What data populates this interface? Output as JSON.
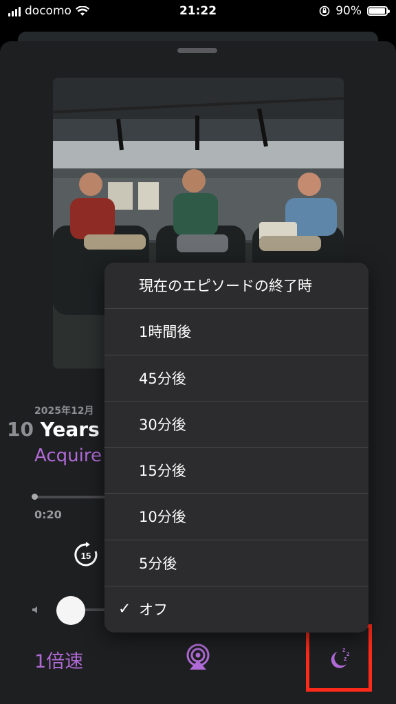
{
  "status_bar": {
    "carrier": "docomo",
    "time": "21:22",
    "battery": "90%",
    "battery_level": 0.9
  },
  "episode": {
    "date": "2025年12月",
    "number": "10",
    "title": "Years o",
    "show": "Acquire",
    "elapsed": "0:20",
    "skip_back_seconds": "15"
  },
  "controls": {
    "speed_label": "1倍速",
    "airplay_icon": "airplay-icon",
    "sleep_icon": "sleep-timer-icon"
  },
  "sleep_menu": {
    "items": [
      {
        "label": "現在のエピソードの終了時",
        "checked": false
      },
      {
        "label": "1時間後",
        "checked": false
      },
      {
        "label": "45分後",
        "checked": false
      },
      {
        "label": "30分後",
        "checked": false
      },
      {
        "label": "15分後",
        "checked": false
      },
      {
        "label": "10分後",
        "checked": false
      },
      {
        "label": "5分後",
        "checked": false
      },
      {
        "label": "オフ",
        "checked": true
      }
    ]
  },
  "colors": {
    "accent": "#b06ad6",
    "highlight": "#ff2a1a"
  }
}
